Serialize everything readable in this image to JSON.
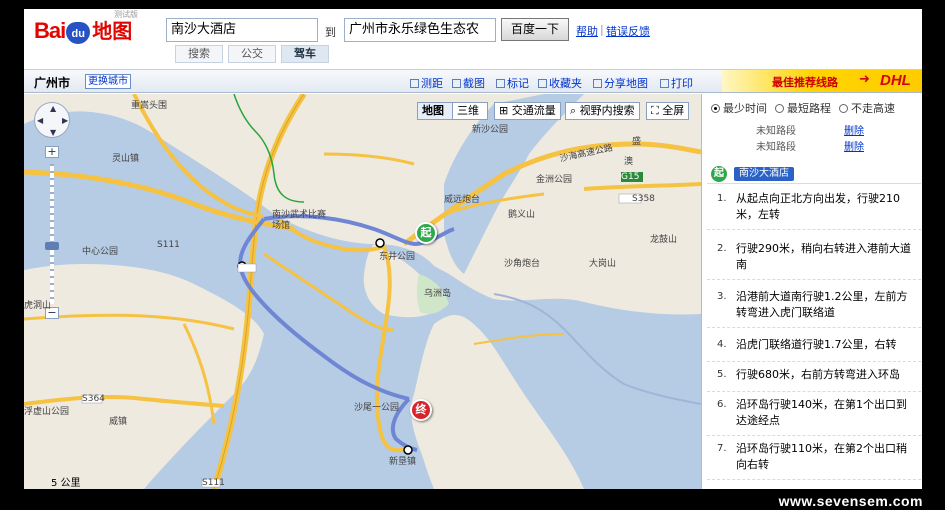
{
  "header": {
    "logo_bai": "Bai",
    "logo_du": "du",
    "logo_map": "地图",
    "beta": "测试版",
    "from_value": "南沙大酒店",
    "to_label": "到",
    "to_value": "广州市永乐绿色生态农",
    "search_button": "百度一下",
    "help_link": "帮助",
    "separator": "|",
    "feedback_link": "错误反馈",
    "tabs": [
      "搜索",
      "公交",
      "驾车"
    ],
    "active_tab": "驾车"
  },
  "toolbar": {
    "city": "广州市",
    "change_city": "更换城市",
    "tools": [
      "测距",
      "截图",
      "标记",
      "收藏夹",
      "分享地图",
      "打印"
    ],
    "ad_text": "最佳推荐线路",
    "ad_arrow": "➜",
    "ad_brand": "DHL"
  },
  "map": {
    "controls": {
      "map_btn": "地图",
      "3d_btn": "三维",
      "traffic_btn": "交通流量",
      "view_search_btn": "视野内搜索",
      "fullscreen_btn": "全屏"
    },
    "zoom_in": "+",
    "zoom_out": "−",
    "scale": "5 公里",
    "start_marker": "起",
    "end_marker": "终",
    "labels": {
      "l1": "重嵩头围",
      "l2": "灵山镇",
      "l3": "中心公园",
      "l4": "浮虚山公园",
      "l5": "威镇",
      "l6": "S111",
      "l7": "S364",
      "l8": "S111",
      "l9": "南沙武术比赛场馆",
      "l10": "东井公园",
      "l11": "威远炮台",
      "l12": "鹅义山",
      "l13": "沙角炮台",
      "l14": "大岗山",
      "l15": "乌洲岛",
      "l16": "沙尾一公园",
      "l17": "新垦镇",
      "l18": "金洲公园",
      "l19": "S358",
      "l20": "G15",
      "l21": "龙鼓山",
      "l22": "沙海高速公路",
      "l23": "新沙公园",
      "l24": "虎洞山",
      "l25": "盛",
      "l26": "澳"
    }
  },
  "panel": {
    "options": [
      "最少时间",
      "最短路程",
      "不走高速"
    ],
    "selected_option": "最少时间",
    "unknown1": "未知路段",
    "unknown2": "未知路段",
    "delete1": "删除",
    "delete2": "删除",
    "start_badge": "起",
    "start_name": "南沙大酒店",
    "steps": [
      {
        "num": "1.",
        "text": "从起点向正北方向出发，行驶210米，左转"
      },
      {
        "num": "2.",
        "text": "行驶290米，稍向右转进入港前大道南"
      },
      {
        "num": "3.",
        "text": "沿港前大道南行驶1.2公里，左前方转弯进入虎门联络道"
      },
      {
        "num": "4.",
        "text": "沿虎门联络道行驶1.7公里，右转"
      },
      {
        "num": "5.",
        "text": "行驶680米，右前方转弯进入环岛"
      },
      {
        "num": "6.",
        "text": "沿环岛行驶140米，在第1个出口到达途经点"
      },
      {
        "num": "7.",
        "text": "沿环岛行驶110米，在第2个出口稍向右转"
      }
    ]
  },
  "watermark": "www.sevensem.com",
  "colors": {
    "brand_red": "#e10601",
    "brand_blue": "#2652c4",
    "route_blue": "#6f86d4",
    "water": "#b6cbe4",
    "highway": "#f5c242",
    "start_green": "#2ea84a",
    "end_red": "#d8232a"
  }
}
